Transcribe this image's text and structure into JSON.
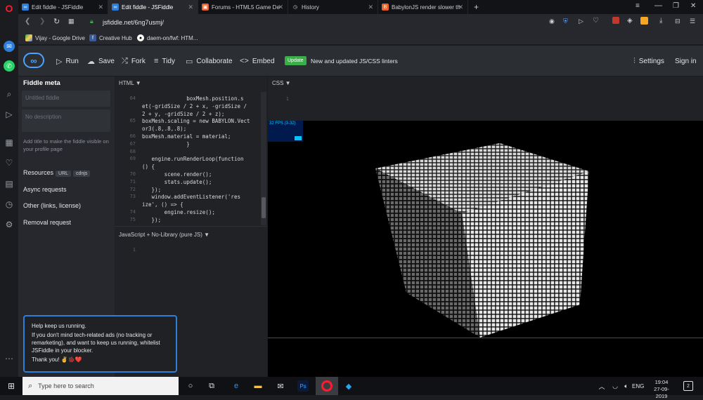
{
  "colors": {
    "accent": "#2f7ed8",
    "update_badge": "#3cae49",
    "result_bg": "#000000"
  },
  "tabs": [
    {
      "label": "Edit fiddle - JSFiddle",
      "icon": "jsfiddle-icon",
      "active": false
    },
    {
      "label": "Edit fiddle - JSFiddle",
      "icon": "jsfiddle-icon",
      "active": true
    },
    {
      "label": "Forums - HTML5 Game De",
      "icon": "forum-icon",
      "active": false
    },
    {
      "label": "History",
      "icon": "history-icon",
      "active": false
    },
    {
      "label": "BabylonJS render slower th",
      "icon": "babylon-icon",
      "active": false
    }
  ],
  "address": {
    "url": "jsfiddle.net/6ng7usmj/"
  },
  "bookmarks": [
    "Vijay - Google Drive",
    "Creative Hub",
    "daem-on/fwf: HTM..."
  ],
  "header": {
    "run": "Run",
    "save": "Save",
    "fork": "Fork",
    "tidy": "Tidy",
    "collaborate": "Collaborate",
    "embed": "Embed",
    "update_badge": "Update",
    "update_text": "New and updated JS/CSS linters",
    "settings": "Settings",
    "signin": "Sign in"
  },
  "meta": {
    "title": "Fiddle meta",
    "title_placeholder": "Untitled fiddle",
    "desc_placeholder": "No description",
    "hint": "Add title to make the fiddle visible on your profile page",
    "resources": "Resources",
    "tag_url": "URL",
    "tag_cdnjs": "cdnjs",
    "async": "Async requests",
    "other": "Other (links, license)",
    "removal": "Removal request"
  },
  "panels": {
    "html": "HTML ▼",
    "css": "CSS ▼",
    "js": "JavaScript + No-Library (pure JS) ▼",
    "css_line": "1",
    "js_line": "1"
  },
  "code_lines": [
    {
      "n": "64",
      "t": "              boxMesh.position.s"
    },
    {
      "n": "",
      "t": "et(-gridSize / 2 + x, -gridSize /"
    },
    {
      "n": "",
      "t": "2 + y, -gridSize / 2 + z);"
    },
    {
      "n": "65",
      "t": "boxMesh.scaling = new BABYLON.Vect"
    },
    {
      "n": "",
      "t": "or3(.8,.8,.8);"
    },
    {
      "n": "66",
      "t": "boxMesh.material = material;"
    },
    {
      "n": "67",
      "t": "              }"
    },
    {
      "n": "68",
      "t": ""
    },
    {
      "n": "69",
      "t": "   engine.runRenderLoop(function"
    },
    {
      "n": "",
      "t": "() {"
    },
    {
      "n": "70",
      "t": "       scene.render();"
    },
    {
      "n": "71",
      "t": "       stats.update();"
    },
    {
      "n": "72",
      "t": "   });"
    },
    {
      "n": "73",
      "t": "   window.addEventListener('res"
    },
    {
      "n": "",
      "t": "ize', () => {"
    },
    {
      "n": "74",
      "t": "       engine.resize();"
    },
    {
      "n": "75",
      "t": "   });"
    }
  ],
  "fps": "32 FPS (3-32)",
  "notice": {
    "title": "Help keep us running.",
    "body": "If you don't mind tech-related ads (no tracking or remarketing), and want to keep us running, whitelist JSFiddle in your blocker.",
    "thanks": "Thank you! ✌️🐞❤️"
  },
  "taskbar": {
    "search": "Type here to search",
    "lang": "ENG",
    "time": "19:04",
    "date": "27-09-2019",
    "notif_count": "2"
  }
}
